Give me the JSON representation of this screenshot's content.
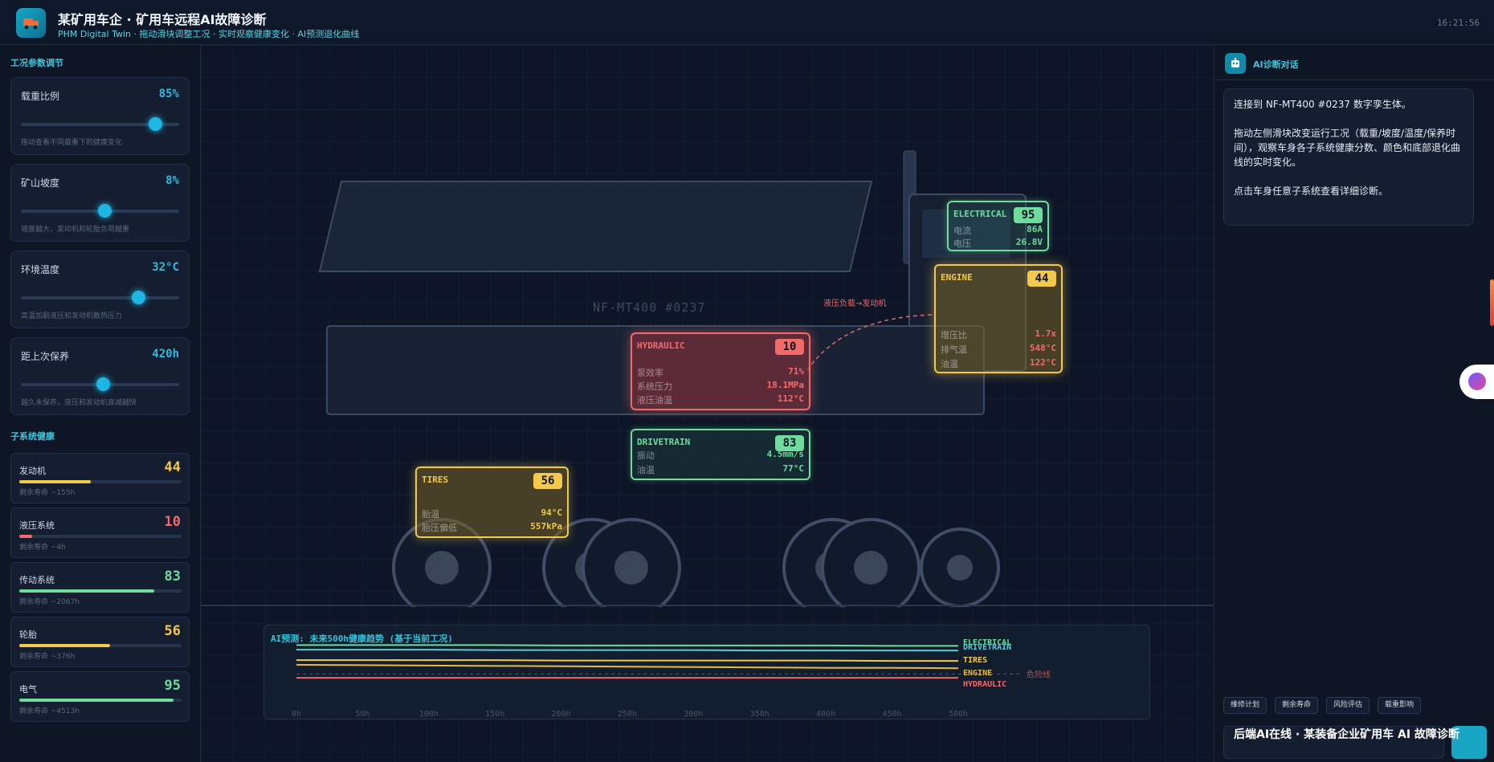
{
  "header": {
    "title": "某矿用车企 · 矿用车远程AI故障诊断",
    "subtitle": "PHM Digital Twin · 拖动滑块调整工况 · 实时观察健康变化 · AI预测退化曲线",
    "time": "16:21:56"
  },
  "left": {
    "params_title": "工况参数调节",
    "params": [
      {
        "label": "载重比例",
        "value": "85%",
        "level": 0.85,
        "hint": "拖动查看不同载重下的健康变化"
      },
      {
        "label": "矿山坡度",
        "value": "8%",
        "level": 0.53,
        "hint": "坡度越大，发动机和轮胎负荷越重"
      },
      {
        "label": "环境温度",
        "value": "32°C",
        "level": 0.74,
        "hint": "高温加剧液压和发动机散热压力"
      },
      {
        "label": "距上次保养",
        "value": "420h",
        "level": 0.52,
        "hint": "越久未保养，液压和发动机衰减越快"
      }
    ],
    "health_title": "子系统健康",
    "health": [
      {
        "label": "发动机",
        "score": "44",
        "life": "剩余寿命 ~155h",
        "level": 0.44,
        "color": "#f2c94c"
      },
      {
        "label": "液压系统",
        "score": "10",
        "life": "剩余寿命 ~4h",
        "level": 0.08,
        "color": "#f16b6b"
      },
      {
        "label": "传动系统",
        "score": "83",
        "life": "剩余寿命 ~2067h",
        "level": 0.83,
        "color": "#6fdc9b"
      },
      {
        "label": "轮胎",
        "score": "56",
        "life": "剩余寿命 ~376h",
        "level": 0.56,
        "color": "#f2c94c"
      },
      {
        "label": "电气",
        "score": "95",
        "life": "剩余寿命 ~4513h",
        "level": 0.95,
        "color": "#6fdc9b"
      }
    ]
  },
  "vehicle": {
    "label": "NF-MT400 #0237",
    "annotation": "液压负载→发动机",
    "cards": {
      "electrical": {
        "name": "ELECTRICAL",
        "score": "95",
        "rows": [
          [
            "电流",
            "86A"
          ],
          [
            "电压",
            "26.8V"
          ]
        ]
      },
      "engine": {
        "name": "ENGINE",
        "score": "44",
        "rows": [
          [
            "增压比",
            "1.7x"
          ],
          [
            "排气温",
            "548°C"
          ],
          [
            "油温",
            "122°C"
          ]
        ]
      },
      "hydraulic": {
        "name": "HYDRAULIC",
        "score": "10",
        "rows": [
          [
            "泵效率",
            "71%"
          ],
          [
            "系统压力",
            "18.1MPa"
          ],
          [
            "液压油温",
            "112°C"
          ]
        ]
      },
      "drivetrain": {
        "name": "DRIVETRAIN",
        "score": "83",
        "rows": [
          [
            "振动",
            "4.5mm/s"
          ],
          [
            "油温",
            "77°C"
          ]
        ]
      },
      "tires": {
        "name": "TIRES",
        "score": "56",
        "rows": [
          [
            "胎温",
            "94°C"
          ],
          [
            "胎压偏低",
            "557kPa"
          ]
        ]
      }
    },
    "colors": {
      "good": "#6fdc9b",
      "warn": "#f2c94c",
      "bad": "#f16b6b"
    }
  },
  "forecast": {
    "title": "AI预测: 未来500h健康趋势 (基于当前工况)",
    "danger_label": "危险线"
  },
  "chart_data": {
    "type": "line",
    "title": "AI预测: 未来500h健康趋势 (基于当前工况)",
    "x": [
      0,
      50,
      100,
      150,
      200,
      250,
      300,
      350,
      400,
      450,
      500
    ],
    "x_tick_labels": [
      "0h",
      "50h",
      "100h",
      "150h",
      "200h",
      "250h",
      "300h",
      "350h",
      "400h",
      "450h",
      "500h"
    ],
    "ylim": [
      0,
      100
    ],
    "danger_line": 20,
    "series": [
      {
        "name": "ELECTRICAL",
        "color": "#6fdc9b",
        "values": [
          95,
          95,
          95,
          95,
          94,
          94,
          94,
          94,
          94,
          93,
          93
        ]
      },
      {
        "name": "DRIVETRAIN",
        "color": "#5fc9d6",
        "values": [
          83,
          83,
          83,
          82,
          82,
          82,
          82,
          81,
          81,
          81,
          81
        ]
      },
      {
        "name": "TIRES",
        "color": "#f2c94c",
        "values": [
          56,
          56,
          56,
          56,
          55,
          55,
          55,
          55,
          55,
          54,
          54
        ]
      },
      {
        "name": "ENGINE",
        "color": "#e8b93e",
        "values": [
          44,
          43,
          42,
          41,
          40,
          39,
          38,
          37,
          36,
          36,
          35
        ]
      },
      {
        "name": "HYDRAULIC",
        "color": "#f16b6b",
        "values": [
          10,
          10,
          10,
          10,
          10,
          10,
          10,
          10,
          10,
          10,
          10
        ]
      }
    ]
  },
  "right": {
    "title": "AI诊断对话",
    "message": [
      "连接到 NF-MT400 #0237 数字孪生体。",
      "拖动左侧滑块改变运行工况（载重/坡度/温度/保养时间），观察车身各子系统健康分数、颜色和底部退化曲线的实时变化。",
      "点击车身任意子系统查看详细诊断。"
    ],
    "quick": [
      "维修计划",
      "剩余寿命",
      "风险评估",
      "载重影响"
    ],
    "input_placeholder": "",
    "toast": "后端AI在线 · 某装备企业矿用车 AI 故障诊断"
  }
}
